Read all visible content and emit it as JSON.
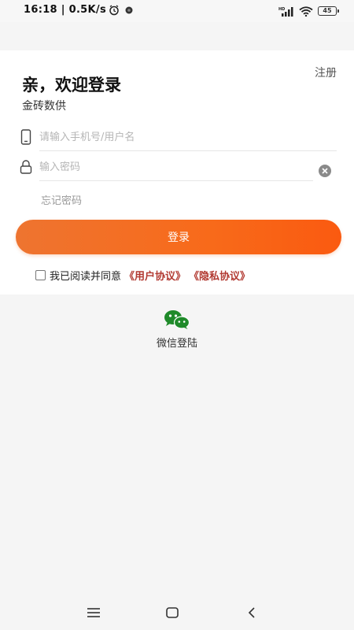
{
  "status_bar": {
    "time": "16:18",
    "network_speed": "| 0.5K/s",
    "battery_level": "45"
  },
  "header": {
    "register_label": "注册",
    "welcome_title": "亲，欢迎登录",
    "subtitle": "金砖数供"
  },
  "form": {
    "phone_placeholder": "请输入手机号/用户名",
    "phone_value": "",
    "password_placeholder": "输入密码",
    "password_value": "",
    "forgot_label": "忘记密码",
    "login_label": "登录"
  },
  "agreement": {
    "checked": false,
    "prefix": "我已阅读并同意",
    "user_agreement": "《用户协议》",
    "privacy_agreement": "《隐私协议》"
  },
  "wechat": {
    "label": "微信登陆"
  },
  "colors": {
    "accent": "#f86a1a",
    "link": "#b23a32",
    "wechat_green": "#1f8a2a"
  }
}
